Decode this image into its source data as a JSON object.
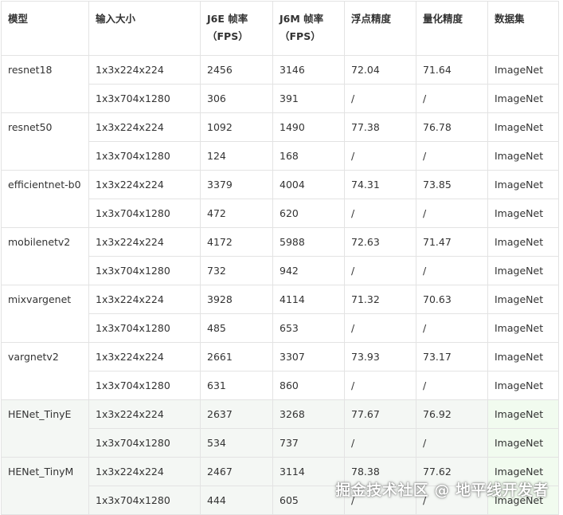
{
  "table": {
    "headers": [
      "模型",
      "输入大小",
      "J6E 帧率\n（FPS）",
      "J6M 帧率\n（FPS）",
      "浮点精度",
      "量化精度",
      "数据集"
    ],
    "groups": [
      {
        "model": "resnet18",
        "highlight": false,
        "rows": [
          [
            "1x3x224x224",
            "2456",
            "3146",
            "72.04",
            "71.64",
            "ImageNet"
          ],
          [
            "1x3x704x1280",
            "306",
            "391",
            "/",
            "/",
            "ImageNet"
          ]
        ]
      },
      {
        "model": "resnet50",
        "highlight": false,
        "rows": [
          [
            "1x3x224x224",
            "1092",
            "1490",
            "77.38",
            "76.78",
            "ImageNet"
          ],
          [
            "1x3x704x1280",
            "124",
            "168",
            "/",
            "/",
            "ImageNet"
          ]
        ]
      },
      {
        "model": "efficientnet-b0",
        "highlight": false,
        "rows": [
          [
            "1x3x224x224",
            "3379",
            "4004",
            "74.31",
            "73.85",
            "ImageNet"
          ],
          [
            "1x3x704x1280",
            "472",
            "620",
            "/",
            "/",
            "ImageNet"
          ]
        ]
      },
      {
        "model": "mobilenetv2",
        "highlight": false,
        "rows": [
          [
            "1x3x224x224",
            "4172",
            "5988",
            "72.63",
            "71.47",
            "ImageNet"
          ],
          [
            "1x3x704x1280",
            "732",
            "942",
            "/",
            "/",
            "ImageNet"
          ]
        ]
      },
      {
        "model": "mixvargenet",
        "highlight": false,
        "rows": [
          [
            "1x3x224x224",
            "3928",
            "4114",
            "71.32",
            "70.63",
            "ImageNet"
          ],
          [
            "1x3x704x1280",
            "485",
            "653",
            "/",
            "/",
            "ImageNet"
          ]
        ]
      },
      {
        "model": "vargnetv2",
        "highlight": false,
        "rows": [
          [
            "1x3x224x224",
            "2661",
            "3307",
            "73.93",
            "73.17",
            "ImageNet"
          ],
          [
            "1x3x704x1280",
            "631",
            "860",
            "/",
            "/",
            "ImageNet"
          ]
        ]
      },
      {
        "model": "HENet_TinyE",
        "highlight": true,
        "rows": [
          [
            "1x3x224x224",
            "2637",
            "3268",
            "77.67",
            "76.92",
            "ImageNet"
          ],
          [
            "1x3x704x1280",
            "534",
            "737",
            "/",
            "/",
            "ImageNet"
          ]
        ]
      },
      {
        "model": "HENet_TinyM",
        "highlight": true,
        "rows": [
          [
            "1x3x224x224",
            "2467",
            "3114",
            "78.38",
            "77.62",
            "ImageNet"
          ],
          [
            "1x3x704x1280",
            "444",
            "605",
            "/",
            "/",
            "ImageNet"
          ]
        ]
      }
    ]
  },
  "watermark": "掘金技术社区 @ 地平线开发者"
}
